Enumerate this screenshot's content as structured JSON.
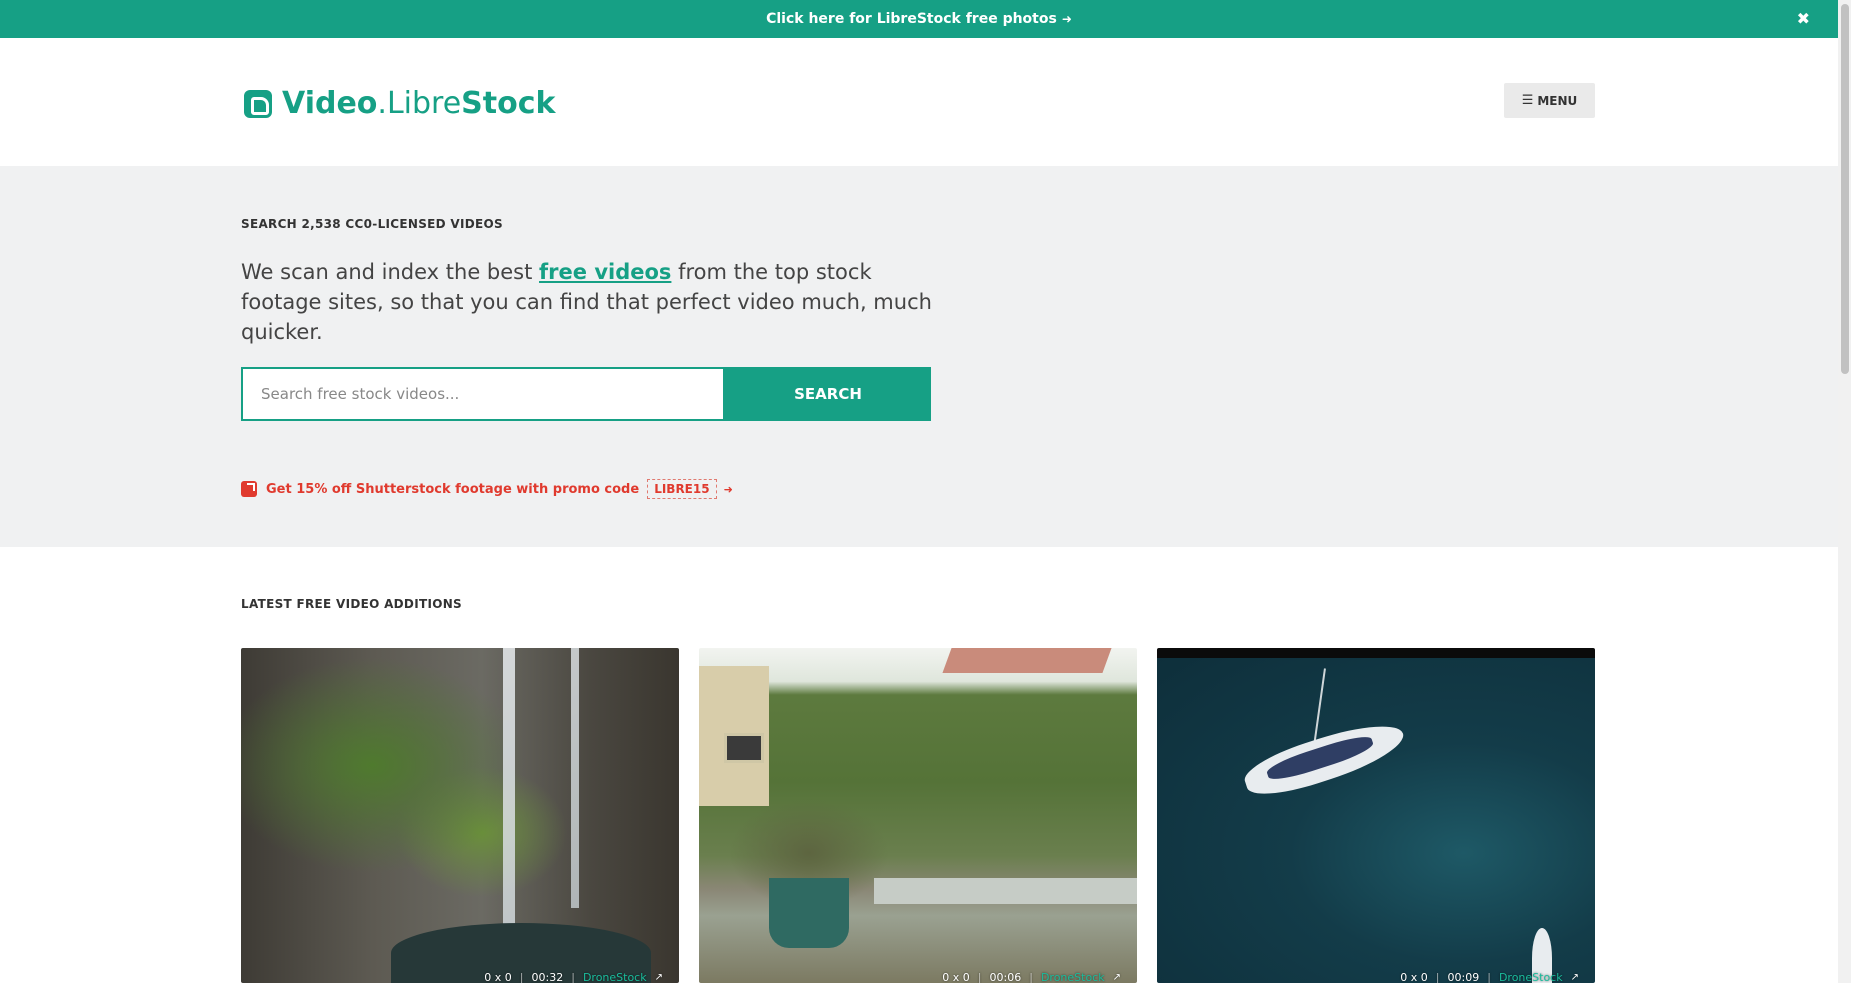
{
  "announcement": {
    "text": "Click here for LibreStock free photos",
    "arrow": "➜",
    "close": "✖"
  },
  "header": {
    "logo": {
      "part1": "Video",
      "part2": ".Libre",
      "part3": "Stock"
    },
    "menu_label": "MENU",
    "menu_icon": "☰"
  },
  "hero": {
    "eyebrow": "SEARCH 2,538 CC0-LICENSED VIDEOS",
    "lead_before": "We scan and index the best ",
    "lead_link": "free videos",
    "lead_after": " from the top stock footage sites, so that you can find that perfect video much, much quicker.",
    "search": {
      "placeholder": "Search free stock videos...",
      "value": "",
      "button_label": "SEARCH"
    },
    "promo": {
      "text": "Get 15% off Shutterstock footage with promo code",
      "code": "LIBRE15",
      "arrow": "➜"
    }
  },
  "latest": {
    "title": "LATEST FREE VIDEO ADDITIONS",
    "items": [
      {
        "dimensions": "0 x 0",
        "duration": "00:32",
        "source": "DroneStock",
        "sep": "|"
      },
      {
        "dimensions": "0 x 0",
        "duration": "00:06",
        "source": "DroneStock",
        "sep": "|"
      },
      {
        "dimensions": "0 x 0",
        "duration": "00:09",
        "source": "DroneStock",
        "sep": "|"
      }
    ]
  },
  "colors": {
    "accent": "#16a085",
    "promo_red": "#e03a2e",
    "hero_bg": "#f0f1f2"
  }
}
